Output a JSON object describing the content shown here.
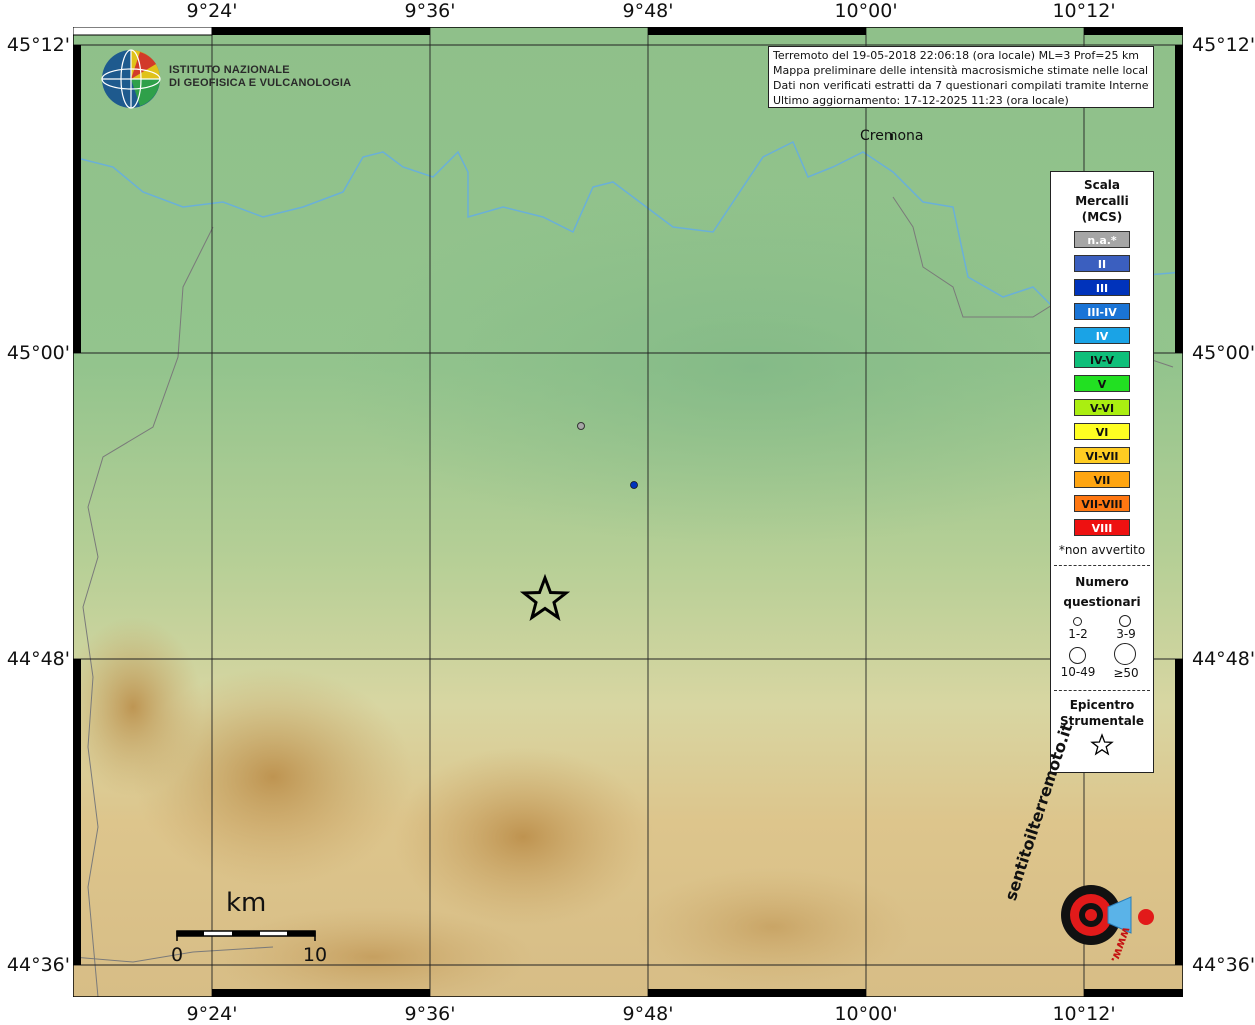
{
  "coordinates": {
    "longitude_labels": [
      "9°24'",
      "9°36'",
      "9°48'",
      "10°00'",
      "10°12'"
    ],
    "latitude_labels": [
      "45°12'",
      "45°00'",
      "44°48'",
      "44°36'"
    ]
  },
  "logo": {
    "line1": "ISTITUTO NAZIONALE",
    "line2": "DI GEOFISICA E VULCANOLOGIA"
  },
  "info": {
    "line1": "Terremoto del 19-05-2018 22:06:18 (ora locale) ML=3 Prof=25 km",
    "line2": "Mappa preliminare delle intensità macrosismiche stimate nelle località",
    "line3": "Dati non verificati estratti da 7 questionari compilati tramite Internet.",
    "line4": "Ultimo aggiornamento: 17-12-2025 11:23 (ora locale)"
  },
  "city": {
    "name": "Cremona"
  },
  "legend": {
    "title_line1": "Scala",
    "title_line2": "Mercalli",
    "title_line3": "(MCS)",
    "levels": [
      {
        "label": "n.a.*",
        "color": "#a6a6a6",
        "text": "#ffffff"
      },
      {
        "label": "II",
        "color": "#3b5fbf",
        "text": "#ffffff"
      },
      {
        "label": "III",
        "color": "#0033bb",
        "text": "#ffffff"
      },
      {
        "label": "III-IV",
        "color": "#1a74d6",
        "text": "#ffffff"
      },
      {
        "label": "IV",
        "color": "#1aa3e6",
        "text": "#ffffff"
      },
      {
        "label": "IV-V",
        "color": "#0fbf7a",
        "text": "#111111"
      },
      {
        "label": "V",
        "color": "#22e022",
        "text": "#111111"
      },
      {
        "label": "V-VI",
        "color": "#aaee11",
        "text": "#111111"
      },
      {
        "label": "VI",
        "color": "#ffff22",
        "text": "#111111"
      },
      {
        "label": "VI-VII",
        "color": "#ffcc22",
        "text": "#111111"
      },
      {
        "label": "VII",
        "color": "#ffa511",
        "text": "#111111"
      },
      {
        "label": "VII-VIII",
        "color": "#ff7711",
        "text": "#111111"
      },
      {
        "label": "VIII",
        "color": "#ee1111",
        "text": "#ffffff"
      }
    ],
    "note": "*non avvertito",
    "count_title_line1": "Numero",
    "count_title_line2": "questionari",
    "count_sizes": [
      "1-2",
      "3-9",
      "10-49",
      "≥50"
    ],
    "epicenter_line1": "Epicentro",
    "epicenter_line2": "Strumentale"
  },
  "observations": [
    {
      "intensity": "n.a.*",
      "color": "#a6a6a6",
      "count": "1-2"
    },
    {
      "intensity": "III",
      "color": "#0033bb",
      "count": "1-2"
    }
  ],
  "scale_bar": {
    "unit": "km",
    "start": "0",
    "end": "10"
  },
  "watermark": {
    "text": "sentitoilterremoto.it",
    "url_text": "www."
  },
  "colors": {
    "river": "#6ab0d8",
    "border": "#7a7a7a",
    "grid": "#222222"
  }
}
